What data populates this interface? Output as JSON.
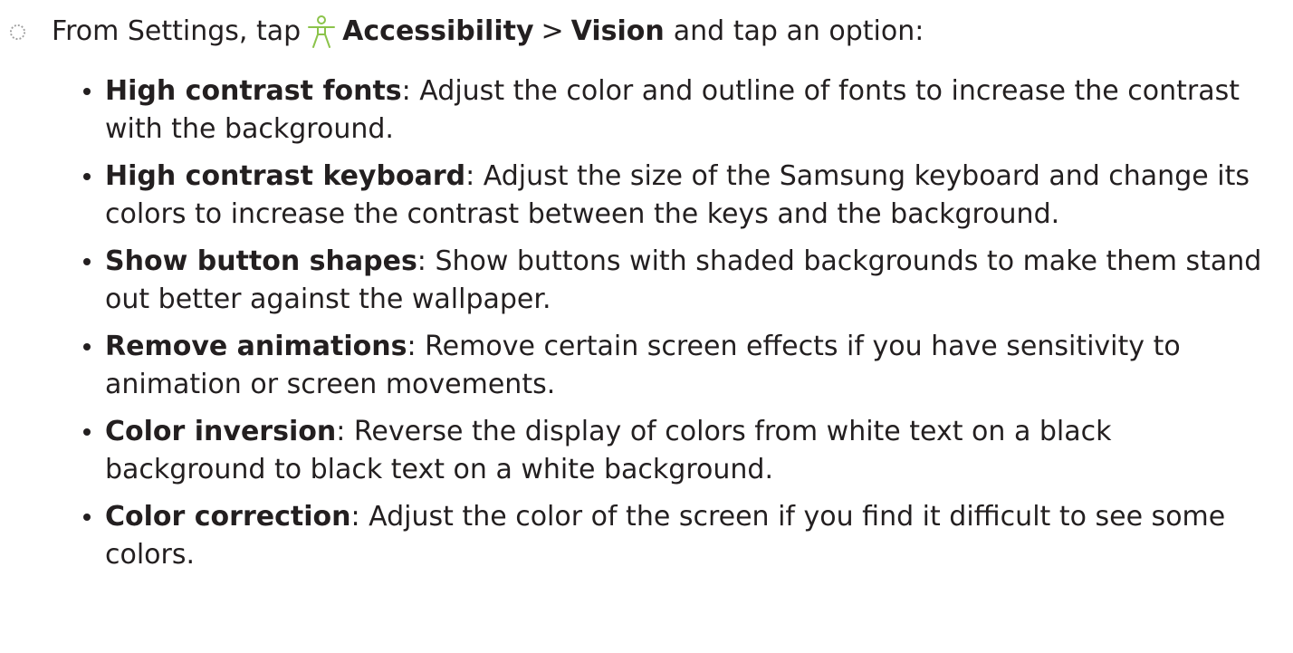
{
  "step": {
    "prefix": "From Settings, tap",
    "icon": "accessibility-icon",
    "menu_1": "Accessibility",
    "separator": ">",
    "menu_2": "Vision",
    "suffix": "and tap an option:"
  },
  "options": [
    {
      "term": "High contrast fonts",
      "description": ": Adjust the color and outline of fonts to increase the contrast with the background."
    },
    {
      "term": "High contrast keyboard",
      "description": ": Adjust the size of the Samsung keyboard and change its colors to increase the contrast between the keys and the background."
    },
    {
      "term": "Show button shapes",
      "description": ": Show buttons with shaded backgrounds to make them stand out better against the wallpaper."
    },
    {
      "term": "Remove animations",
      "description": ": Remove certain screen effects if you have sensitivity to animation or screen movements."
    },
    {
      "term": "Color inversion",
      "description": ": Reverse the display of colors from white text on a black background to black text on a white background."
    },
    {
      "term": "Color correction",
      "description": ": Adjust the color of the screen if you find it difficult to see some colors."
    }
  ],
  "colors": {
    "text": "#231f20",
    "icon_accent": "#8bc34a",
    "marker": "#9e9e9e"
  }
}
